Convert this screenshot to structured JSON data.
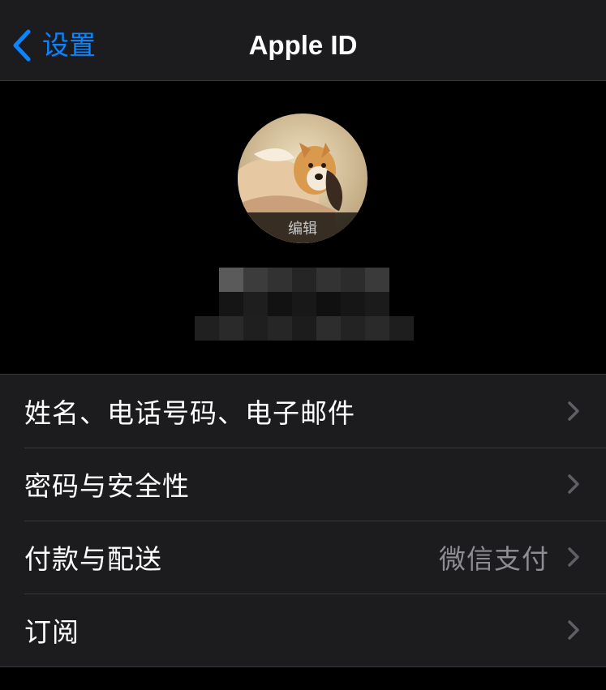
{
  "nav": {
    "back_label": "设置",
    "title": "Apple ID"
  },
  "profile": {
    "edit_label": "编辑"
  },
  "settings_rows": [
    {
      "label": "姓名、电话号码、电子邮件",
      "value": ""
    },
    {
      "label": "密码与安全性",
      "value": ""
    },
    {
      "label": "付款与配送",
      "value": "微信支付"
    },
    {
      "label": "订阅",
      "value": ""
    }
  ],
  "icons": {
    "back": "chevron-left-icon",
    "row_disclosure": "chevron-right-icon"
  },
  "colors": {
    "accent": "#0a84ff",
    "background": "#000000",
    "cell_background": "#1c1c1e",
    "separator": "#38383a",
    "secondary_text": "#8d8d92"
  }
}
